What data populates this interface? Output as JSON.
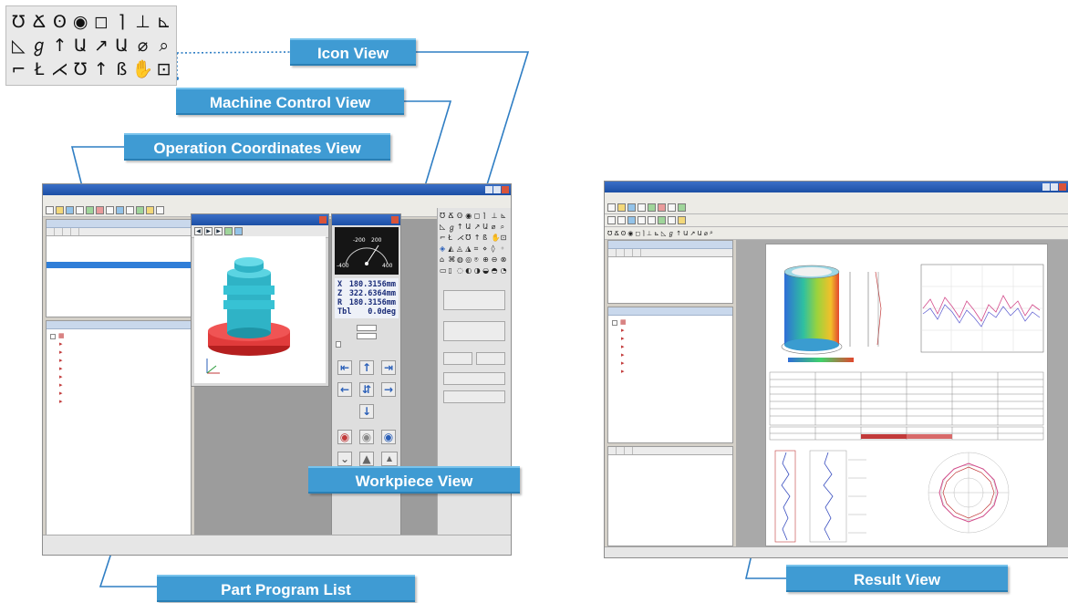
{
  "callouts": {
    "icon_view": "Icon View",
    "machine_control_view": "Machine Control View",
    "operation_coordinates_view": "Operation Coordinates View",
    "workpiece_view": "Workpiece View",
    "part_program_list": "Part Program List",
    "result_view": "Result View"
  },
  "palette_icons": [
    "Ʊ",
    "Ճ",
    "ʘ",
    "◉",
    "◻",
    "⌉",
    "⊥",
    "⊾",
    "◺",
    "ℊ",
    "↑",
    "Ա",
    "↗",
    "Ա",
    "⌀",
    "⌕",
    "⌐",
    "Ł",
    "⋌",
    "Ʊ",
    "↑",
    "ß",
    "✋",
    "⊡"
  ],
  "machine_control": {
    "dial_ticks": [
      "-200",
      "200",
      "-400",
      "400"
    ],
    "readout": [
      {
        "axis": "X",
        "value": "180.3156mm"
      },
      {
        "axis": "Z",
        "value": "322.6364mm"
      },
      {
        "axis": "R",
        "value": "180.3156mm"
      },
      {
        "axis": "Tbl",
        "value": "0.0deg"
      }
    ],
    "arrows": [
      "⇤",
      "↑",
      "⇥",
      "←",
      "⇵",
      "→",
      "↓"
    ]
  },
  "colors": {
    "callout": "#3f9bd3",
    "leader": "#2f7ec4",
    "selection": "#2f7ed8",
    "workpiece_body": "#2fb3c6",
    "workpiece_base": "#e13b3b"
  }
}
